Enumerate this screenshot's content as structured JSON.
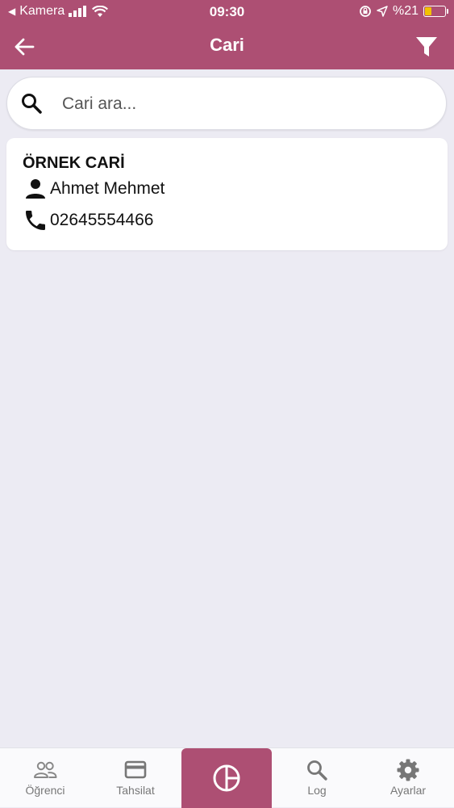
{
  "status_bar": {
    "back_app": "Kamera",
    "time": "09:30",
    "battery": "%21"
  },
  "header": {
    "title": "Cari"
  },
  "search": {
    "placeholder": "Cari ara..."
  },
  "cari_list": [
    {
      "name": "ÖRNEK CARİ",
      "contact": "Ahmet Mehmet",
      "phone": "02645554466"
    }
  ],
  "bottom_nav": {
    "items": [
      {
        "label": "Öğrenci",
        "icon": "people-icon"
      },
      {
        "label": "Tahsilat",
        "icon": "credit-card-icon"
      },
      {
        "label": "",
        "icon": "pie-chart-icon"
      },
      {
        "label": "Log",
        "icon": "search-icon"
      },
      {
        "label": "Ayarlar",
        "icon": "gear-icon"
      }
    ]
  },
  "colors": {
    "primary": "#ad4f73",
    "background": "#ecebf3",
    "card": "#ffffff",
    "nav_inactive": "#777777"
  }
}
